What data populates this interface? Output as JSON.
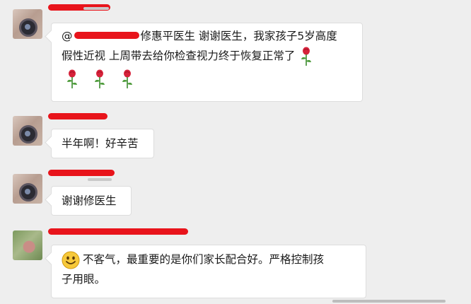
{
  "messages": [
    {
      "avatar": "camera-avatar",
      "mention_prefix": "@",
      "text_line1_after_mention": "修惠平医生 谢谢医生，我家孩子5岁高度",
      "text_line2": "假性近视 上周带去给你检查视力终于恢复正常了",
      "emoji": "rose-emoji"
    },
    {
      "avatar": "camera-avatar",
      "text": "半年啊！好辛苦"
    },
    {
      "avatar": "camera-avatar",
      "text": "谢谢修医生"
    },
    {
      "avatar": "flower-avatar",
      "emoji": "smiley-emoji",
      "text_line1": "不客气，最重要的是你们家长配合好。严格控制孩",
      "text_line2": "子用眼。"
    }
  ],
  "colors": {
    "background": "#eeeeee",
    "bubble": "#ffffff",
    "redaction": "#e8141b"
  }
}
